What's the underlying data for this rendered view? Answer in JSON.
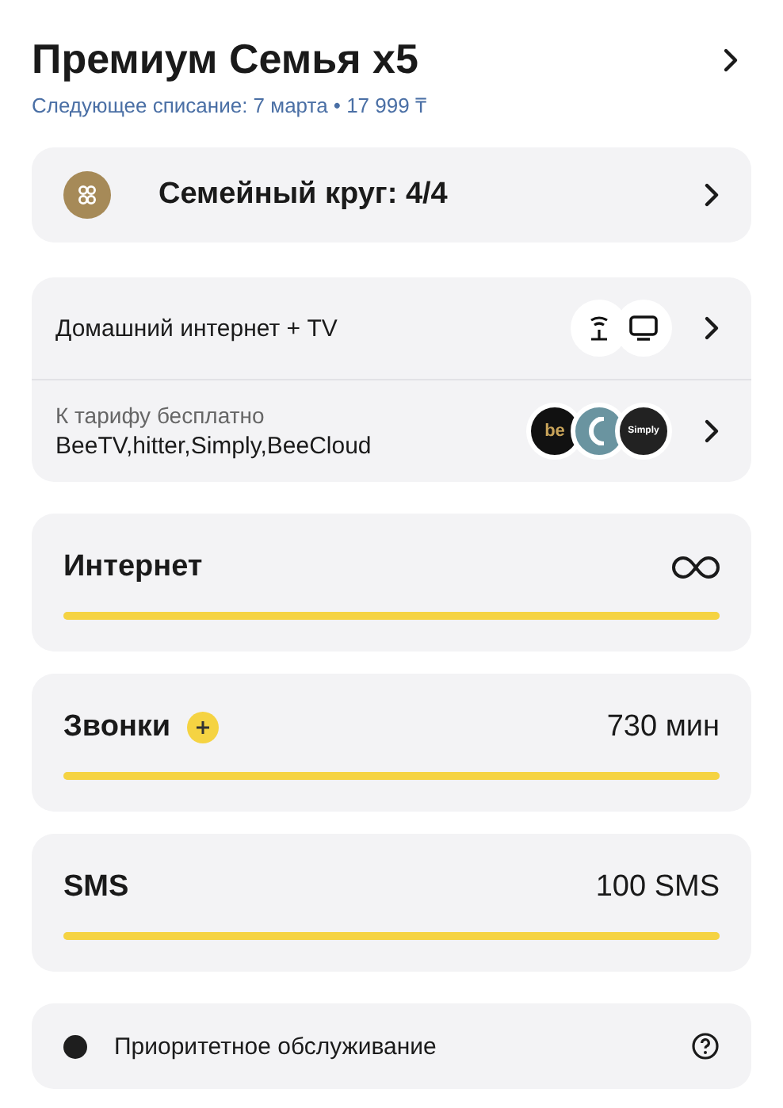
{
  "header": {
    "title": "Премиум Семья x5",
    "subtitle": "Следующее списание: 7 марта • 17 999 ₸"
  },
  "family": {
    "label": "Семейный круг: 4/4"
  },
  "services": [
    {
      "kind": "home",
      "title": "Домашний интернет + TV"
    },
    {
      "kind": "free",
      "caption": "К тарифу бесплатно",
      "title": "BeeTV,hitter,Simply,BeeCloud",
      "logos": [
        {
          "kind": "bee",
          "label": "be"
        },
        {
          "kind": "hitter"
        },
        {
          "kind": "simply",
          "label": "Simply"
        }
      ]
    }
  ],
  "meters": [
    {
      "kind": "unlimited",
      "name": "Интернет",
      "level": 1,
      "plus": false
    },
    {
      "kind": "amount",
      "name": "Звонки",
      "value": "730 мин",
      "level": 1,
      "plus": true
    },
    {
      "kind": "amount",
      "name": "SMS",
      "value": "100 SMS",
      "level": 1,
      "plus": false
    }
  ],
  "priority": {
    "label": "Приоритетное обслуживание",
    "active": true
  }
}
